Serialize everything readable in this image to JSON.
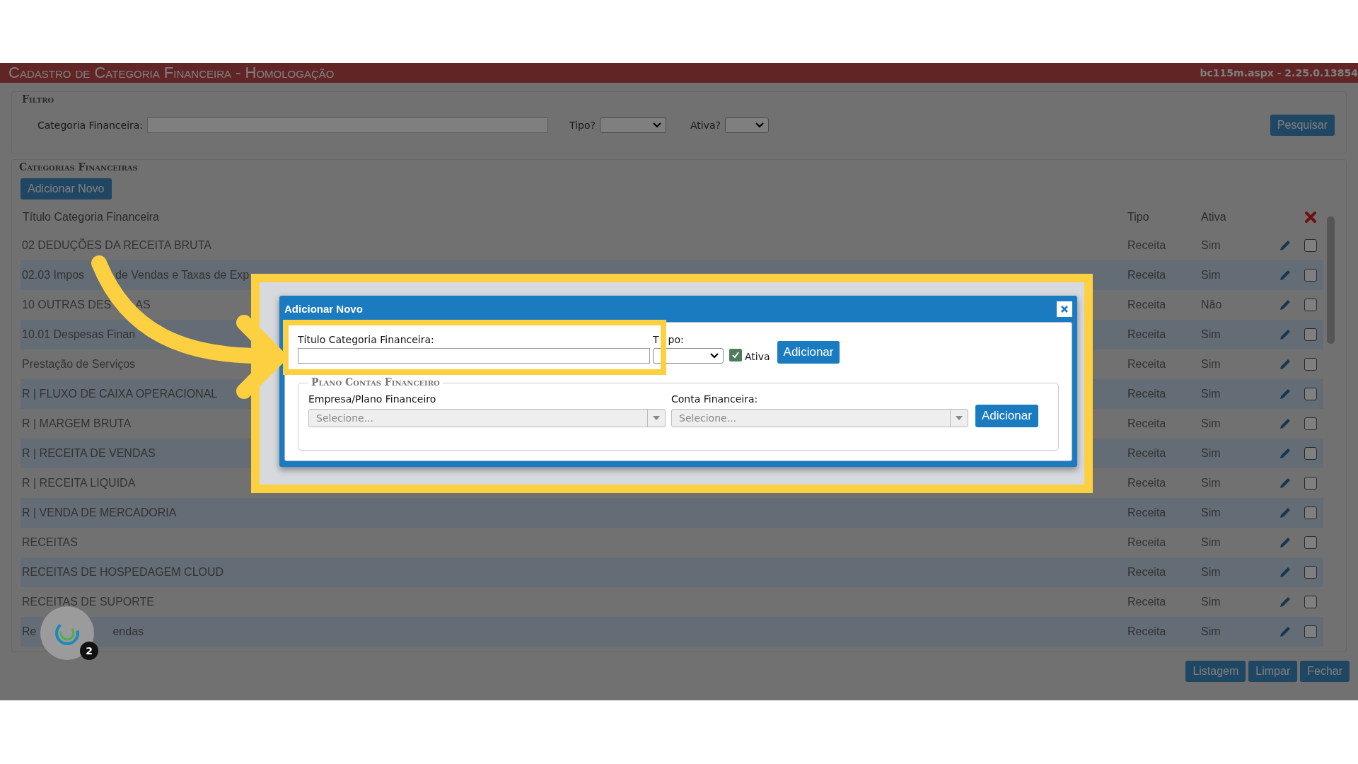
{
  "header": {
    "title": "Cadastro de Categoria Financeira  - Homologação",
    "version": "bc115m.aspx - 2.25.0.13854"
  },
  "filter": {
    "legend": "Filtro",
    "fields": [
      {
        "label": "Categoria Financeira:",
        "kind": "text"
      },
      {
        "label": "Tipo?",
        "kind": "select"
      },
      {
        "label": "Ativa?",
        "kind": "select"
      }
    ],
    "search_button": "Pesquisar"
  },
  "categories": {
    "legend": "Categorias Financeiras",
    "add_button": "Adicionar Novo",
    "columns": [
      "Título Categoria Financeira",
      "Tipo",
      "Ativa"
    ],
    "rows": [
      {
        "title": [
          "02 DEDUÇÕES DA RECEITA BRUTA"
        ],
        "tipo": "Receita",
        "ativa": "Sim",
        "checked": false
      },
      {
        "title": [
          "02.03 Impos",
          "de Vendas e Taxas de Exp"
        ],
        "tipo": "Receita",
        "ativa": "Sim",
        "checked": false
      },
      {
        "title": [
          "10 OUTRAS DES",
          "AS"
        ],
        "tipo": "Receita",
        "ativa": "Não",
        "checked": false
      },
      {
        "title": [
          "10.01 Despesas Finan"
        ],
        "tipo": "Receita",
        "ativa": "Sim",
        "checked": false
      },
      {
        "title": [
          "Prestação de Serviços"
        ],
        "tipo": "Receita",
        "ativa": "Sim",
        "checked": false
      },
      {
        "title": [
          "R | FLUXO DE CAIXA OPERACIONAL"
        ],
        "tipo": "Receita",
        "ativa": "Sim",
        "checked": false
      },
      {
        "title": [
          "R | MARGEM BRUTA"
        ],
        "tipo": "Receita",
        "ativa": "Sim",
        "checked": false
      },
      {
        "title": [
          "R | RECEITA DE VENDAS"
        ],
        "tipo": "Receita",
        "ativa": "Sim",
        "checked": false
      },
      {
        "title": [
          "R | RECEITA LIQUIDA"
        ],
        "tipo": "Receita",
        "ativa": "Sim",
        "checked": false
      },
      {
        "title": [
          "R | VENDA DE MERCADORIA"
        ],
        "tipo": "Receita",
        "ativa": "Sim",
        "checked": false
      },
      {
        "title": [
          "RECEITAS"
        ],
        "tipo": "Receita",
        "ativa": "Sim",
        "checked": false
      },
      {
        "title": [
          "RECEITAS DE HOSPEDAGEM CLOUD"
        ],
        "tipo": "Receita",
        "ativa": "Sim",
        "checked": false
      },
      {
        "title": [
          "RECEITAS DE SUPORTE"
        ],
        "tipo": "Receita",
        "ativa": "Sim",
        "checked": false
      },
      {
        "title": [
          "Re",
          "endas"
        ],
        "tipo": "Receita",
        "ativa": "Sim",
        "checked": false
      }
    ]
  },
  "footer_buttons": [
    "Listagem",
    "Limpar",
    "Fechar"
  ],
  "chat_bubble": {
    "badge": "2"
  },
  "dialog": {
    "title": "Adicionar Novo",
    "title_label": "Título Categoria Financeira:",
    "tipo_label": [
      "T",
      "po:"
    ],
    "ativa": {
      "label": "Ativa",
      "checked": true
    },
    "add_button": "Adicionar",
    "plano": {
      "legend": "Plano Contas Financeiro",
      "fields": [
        {
          "label": "Empresa/Plano Financeiro",
          "placeholder": "Selecione..."
        },
        {
          "label": "Conta Financeira:",
          "placeholder": "Selecione..."
        }
      ],
      "add_button": "Adicionar"
    }
  }
}
